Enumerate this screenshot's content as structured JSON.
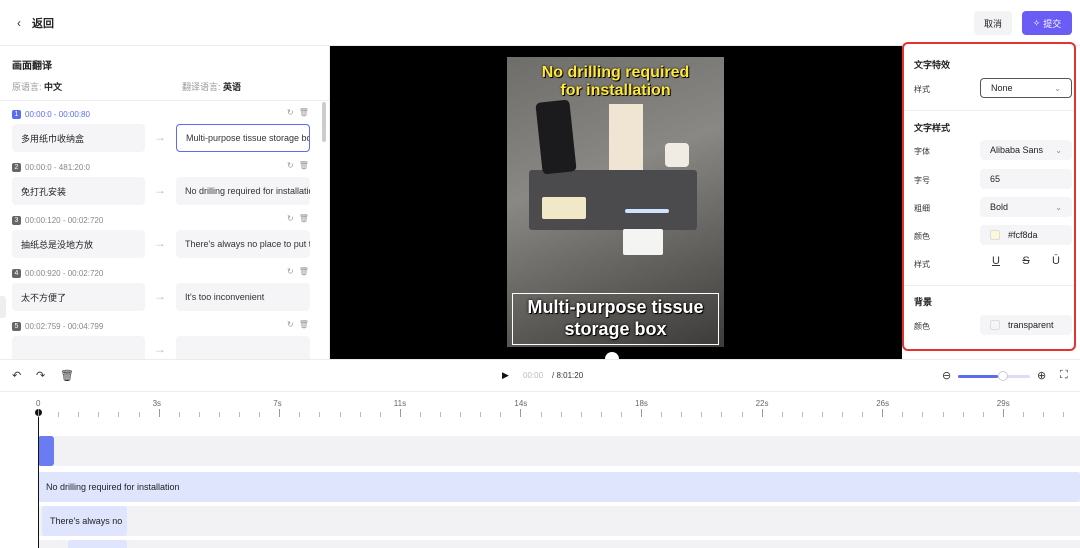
{
  "header": {
    "back_label": "返回",
    "back_icon": "chevron-left-icon",
    "cancel_label": "取消",
    "submit_label": "提交",
    "submit_icon": "sparkle-icon",
    "accent_color": "#6b5cf6"
  },
  "left_panel": {
    "title": "画面翻译",
    "source_lang_label": "原语言:",
    "source_lang": "中文",
    "target_lang_label": "翻译语言:",
    "target_lang": "英语",
    "segments": [
      {
        "index": "1",
        "time": "00:00:0 - 00:00:80",
        "source": "多用纸巾收纳盒",
        "target": "Multi-purpose tissue storage box"
      },
      {
        "index": "2",
        "time": "00:00:0 - 481:20:0",
        "source": "免打孔安装",
        "target": "No drilling required for installation"
      },
      {
        "index": "3",
        "time": "00:00:120 - 00:02:720",
        "source": "抽纸总是没地方放",
        "target": "There's always no place to put tissues"
      },
      {
        "index": "4",
        "time": "00:00:920 - 00:02:720",
        "source": "太不方便了",
        "target": "It's too inconvenient"
      },
      {
        "index": "5",
        "time": "00:02:759 - 00:04:799",
        "source": "",
        "target": ""
      }
    ]
  },
  "video": {
    "caption_top_line1": "No drilling required",
    "caption_top_line2": "for installation",
    "caption_bottom_line1": "Multi-purpose tissue",
    "caption_bottom_line2": "storage box",
    "caption_top_color": "#ffe83a"
  },
  "right_panel": {
    "effects_title": "文字特效",
    "effect_style_label": "样式",
    "effect_style_value": "None",
    "text_style_title": "文字样式",
    "font_label": "字体",
    "font_value": "Alibaba Sans",
    "size_label": "字号",
    "size_value": "65",
    "weight_label": "粗细",
    "weight_value": "Bold",
    "color_label": "颜色",
    "color_value": "#fcf8da",
    "style_label": "样式",
    "style_buttons": [
      "U",
      "S",
      "Ū"
    ],
    "background_title": "背景",
    "bg_color_label": "颜色",
    "bg_color_value": "transparent",
    "highlight_border_color": "#e4322f"
  },
  "toolbar": {
    "undo_icon": "undo-icon",
    "redo_icon": "redo-icon",
    "delete_icon": "trash-icon",
    "play_icon": "play-icon",
    "current_time": "00:00",
    "total_time": "/ 8:01:20",
    "zoom_out_icon": "zoom-out-icon",
    "zoom_in_icon": "zoom-in-icon",
    "fit_icon": "fit-screen-icon",
    "zoom_level": 0.55
  },
  "timeline": {
    "ticks": [
      "0",
      "3s",
      "7s",
      "11s",
      "14s",
      "18s",
      "22s",
      "26s",
      "29s"
    ],
    "clips": [
      {
        "label": "No drilling required for installation"
      },
      {
        "label": "There's always no"
      }
    ]
  }
}
